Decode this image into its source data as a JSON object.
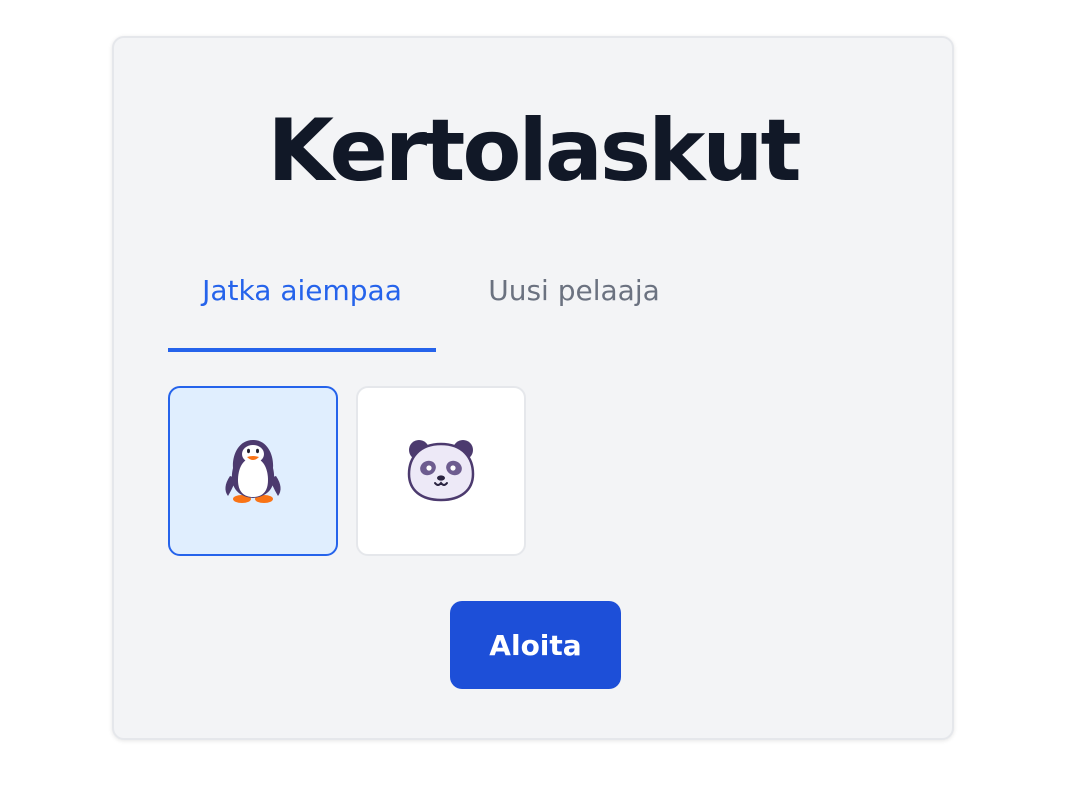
{
  "app": {
    "title": "Kertolaskut"
  },
  "tabs": [
    {
      "label": "Jatka aiempaa",
      "active": true
    },
    {
      "label": "Uusi pelaaja",
      "active": false
    }
  ],
  "avatars": [
    {
      "icon": "penguin-icon",
      "selected": true
    },
    {
      "icon": "panda-icon",
      "selected": false
    }
  ],
  "actions": {
    "start_label": "Aloita"
  },
  "colors": {
    "accent": "#2563eb",
    "button": "#1d4fd8",
    "title": "#111827",
    "muted_tab": "#6b7280",
    "card_bg": "#f3f4f6",
    "selected_tile_bg": "#e0eefe"
  }
}
